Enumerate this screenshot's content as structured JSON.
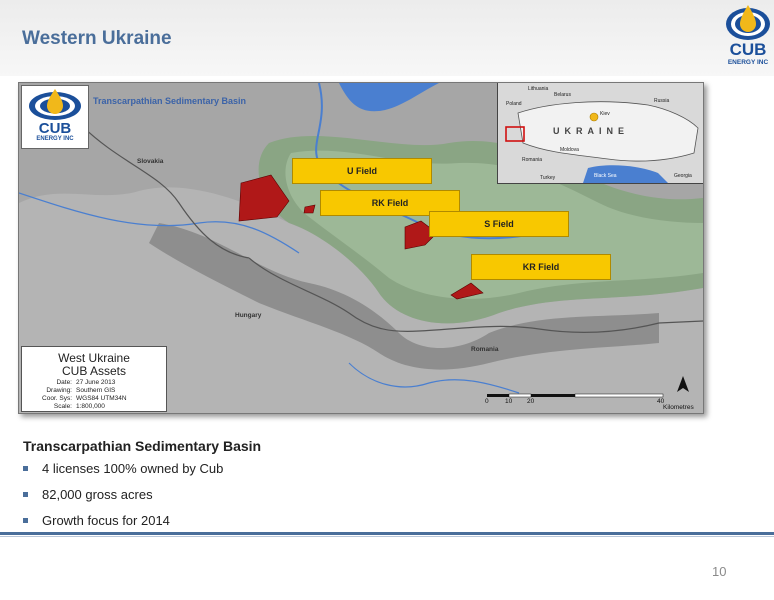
{
  "slide": {
    "title": "Western Ukraine",
    "page_number": "10",
    "logo": {
      "name": "CUB",
      "tagline": "ENERGY INC"
    }
  },
  "map": {
    "basin_label": "Transcarpathian Sedimentary Basin",
    "regions": {
      "slovakia": "Slovakia",
      "hungary": "Hungary",
      "romania": "Romania"
    },
    "fields": {
      "u": "U Field",
      "rk": "RK Field",
      "s": "S Field",
      "kr": "KR Field"
    },
    "inset": {
      "country": "UKRAINE",
      "labels": {
        "lithuania": "Lithuania",
        "belarus": "Belarus",
        "russia": "Russia",
        "poland": "Poland",
        "kiev": "Kiev",
        "moldova": "Moldova",
        "romania": "Romania",
        "black_sea": "Black Sea",
        "georgia": "Georgia",
        "turkey": "Turkey"
      }
    },
    "legend": {
      "title_line1": "West Ukraine",
      "title_line2": "CUB Assets",
      "rows": [
        {
          "k": "Date:",
          "v": "27 June 2013"
        },
        {
          "k": "Drawing:",
          "v": "Southern GIS"
        },
        {
          "k": "Coor. Sys:",
          "v": "WGS84 UTM34N"
        },
        {
          "k": "Scale:",
          "v": "1:800,000"
        }
      ]
    },
    "scale_bar": {
      "ticks": [
        "0",
        "10",
        "20",
        "40"
      ],
      "unit": "Kilometres"
    },
    "north": "N",
    "colors": {
      "license": "#b01818",
      "field_label": "#f8c800",
      "water": "#4a7fd0"
    }
  },
  "body": {
    "subtitle": "Transcarpathian Sedimentary Basin",
    "bullets": [
      "4 licenses 100% owned by Cub",
      "82,000 gross acres",
      "Growth focus for 2014"
    ],
    "bullet_color": "#4a6e9a"
  }
}
